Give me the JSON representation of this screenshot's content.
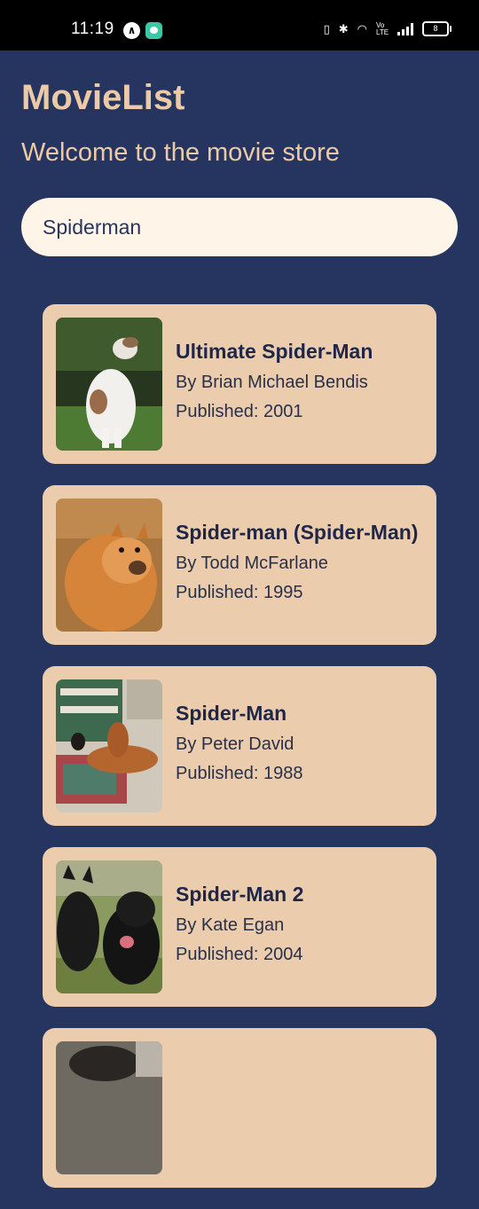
{
  "status_bar": {
    "time": "11:19",
    "battery_level": "8",
    "volte_label": "Vo LTE"
  },
  "header": {
    "title": "MovieList",
    "subtitle": "Welcome to the movie store"
  },
  "search": {
    "value": "Spiderman"
  },
  "items": [
    {
      "title": "Ultimate Spider-Man",
      "author": "By Brian Michael Bendis",
      "published": "Published: 2001",
      "image": "borzoi-dog-photo"
    },
    {
      "title": "Spider-man (Spider-Man)",
      "author": "By Todd McFarlane",
      "published": "Published: 1995",
      "image": "chow-chow-dog-photo"
    },
    {
      "title": "Spider-Man",
      "author": "By Peter David",
      "published": "Published: 1988",
      "image": "bloodhound-dog-photo"
    },
    {
      "title": "Spider-Man 2",
      "author": "By Kate Egan",
      "published": "Published: 2004",
      "image": "black-dogs-photo"
    }
  ],
  "colors": {
    "background": "#263560",
    "accent_text": "#ecc9a7",
    "card": "#ebcdad",
    "search_bg": "#fff4e8"
  }
}
